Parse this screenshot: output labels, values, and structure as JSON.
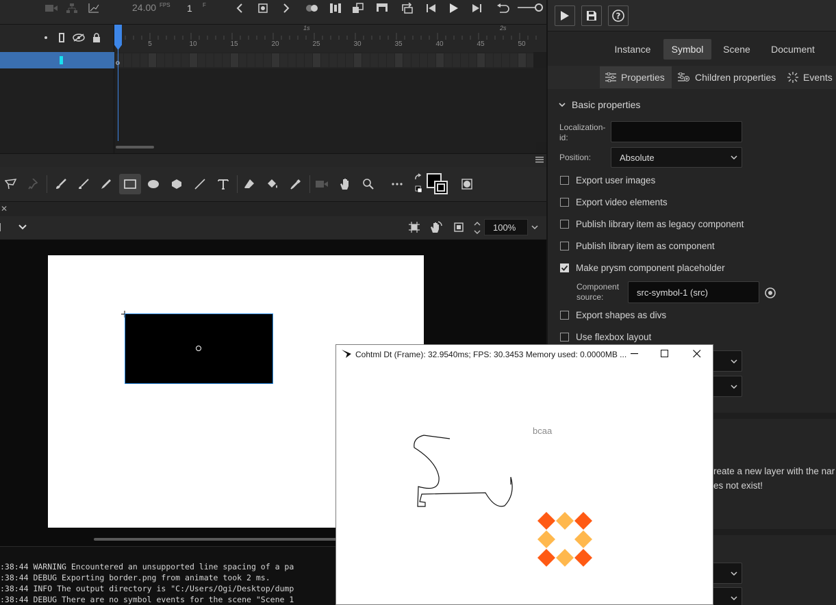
{
  "timeline": {
    "fps_value": "24.00",
    "fps_unit": "FPS",
    "frame_value": "1",
    "frame_unit": "F",
    "ruler_numbers": [
      "5",
      "10",
      "15",
      "20",
      "25",
      "30",
      "35",
      "40",
      "45",
      "50"
    ],
    "ruler_seconds": [
      "1s",
      "2s"
    ]
  },
  "stage": {
    "zoom": "100%"
  },
  "console": {
    "lines": [
      ":38:44 WARNING Encountered an unsupported line spacing of a pa",
      ":38:44 DEBUG Exporting border.png from animate took 2 ms.",
      ":38:44 INFO The output directory is \"C:/Users/Ogi/Desktop/dump",
      ":38:44 DEBUG There are no symbol events for the scene \"Scene 1"
    ]
  },
  "panel": {
    "tabs": [
      "Instance",
      "Symbol",
      "Scene",
      "Document"
    ],
    "subtabs": [
      "Properties",
      "Children properties",
      "Events"
    ],
    "section_title": "Basic properties",
    "localization_label_1": "Localization-",
    "localization_label_2": "id:",
    "localization_value": "",
    "position_label": "Position:",
    "position_value": "Absolute",
    "checks": [
      {
        "label": "Export user images",
        "checked": false
      },
      {
        "label": "Export video elements",
        "checked": false
      },
      {
        "label": "Publish library item as legacy component",
        "checked": false
      },
      {
        "label": "Publish library item as component",
        "checked": false
      },
      {
        "label": "Make prysm component placeholder",
        "checked": true
      }
    ],
    "component_source_label_1": "Component",
    "component_source_label_2": "source:",
    "component_source_value": "src-symbol-1 (src)",
    "checks2": [
      {
        "label": "Export shapes as divs",
        "checked": false
      },
      {
        "label": "Use flexbox layout",
        "checked": false
      }
    ],
    "hint_line_1": "reate a new layer with the nar",
    "hint_line_2": "es not exist!"
  },
  "debug_window": {
    "title": "Cohtml Dt (Frame): 32.9540ms; FPS: 30.3453 Memory used: 0.0000MB ...",
    "label": "bcaa"
  },
  "colors": {
    "selection_blue": "#3a6fb1",
    "playhead": "#3d86e8",
    "diamond_orange": "#ff5a14",
    "diamond_light": "#ffb84d"
  }
}
